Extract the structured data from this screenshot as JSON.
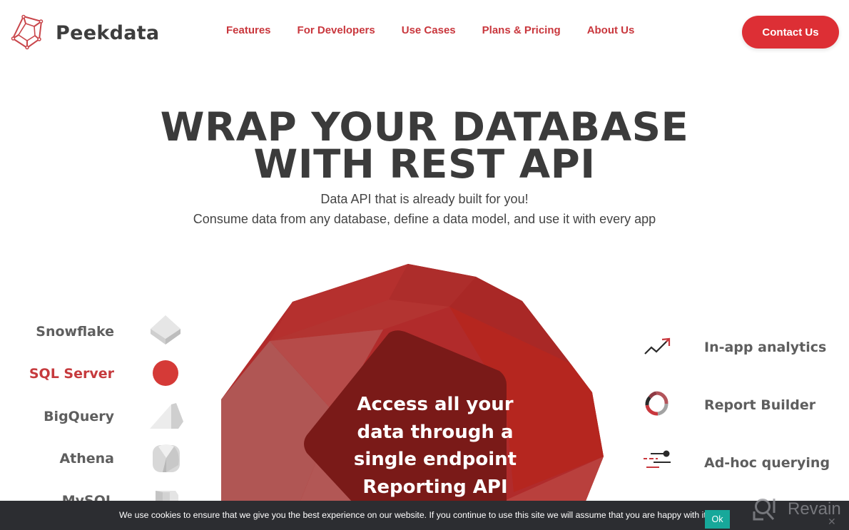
{
  "header": {
    "brand": "Peekdata",
    "nav": [
      "Features",
      "For Developers",
      "Use Cases",
      "Plans & Pricing",
      "About Us"
    ],
    "contact_label": "Contact Us"
  },
  "hero": {
    "title_line1": "WRAP YOUR DATABASE",
    "title_line2": "WITH REST API",
    "subtitle1": "Data API that is already built for you!",
    "subtitle2": "Consume data from any database, define a data model, and use it with every app"
  },
  "graphic": {
    "lines": [
      "Access all your",
      "data through a",
      "single endpoint",
      "Reporting API"
    ]
  },
  "databases": [
    {
      "label": "Snowflake",
      "icon": "cube-flat-icon",
      "active": false
    },
    {
      "label": "SQL Server",
      "icon": "sphere-icon",
      "active": true
    },
    {
      "label": "BigQuery",
      "icon": "prism-icon",
      "active": false
    },
    {
      "label": "Athena",
      "icon": "rounded-cube-icon",
      "active": false
    },
    {
      "label": "MySQL",
      "icon": "cylinder-icon",
      "active": false
    }
  ],
  "features": [
    {
      "label": "In-app analytics",
      "icon": "trend-arrow-icon"
    },
    {
      "label": "Report Builder",
      "icon": "donut-chart-icon"
    },
    {
      "label": "Ad-hoc querying",
      "icon": "filter-slider-icon"
    }
  ],
  "cookie": {
    "message": "We use cookies to ensure that we give you the best experience on our website. If you continue to use this site we will assume that you are happy with it.",
    "ok_label": "Ok"
  },
  "watermark": {
    "label": "Revain"
  },
  "colors": {
    "brand_red": "#dd2f35",
    "nav_red": "#c9373d",
    "text_dark": "#3b3b3b",
    "cookie_bg": "#2c2d31",
    "ok_teal": "#17a89a"
  }
}
